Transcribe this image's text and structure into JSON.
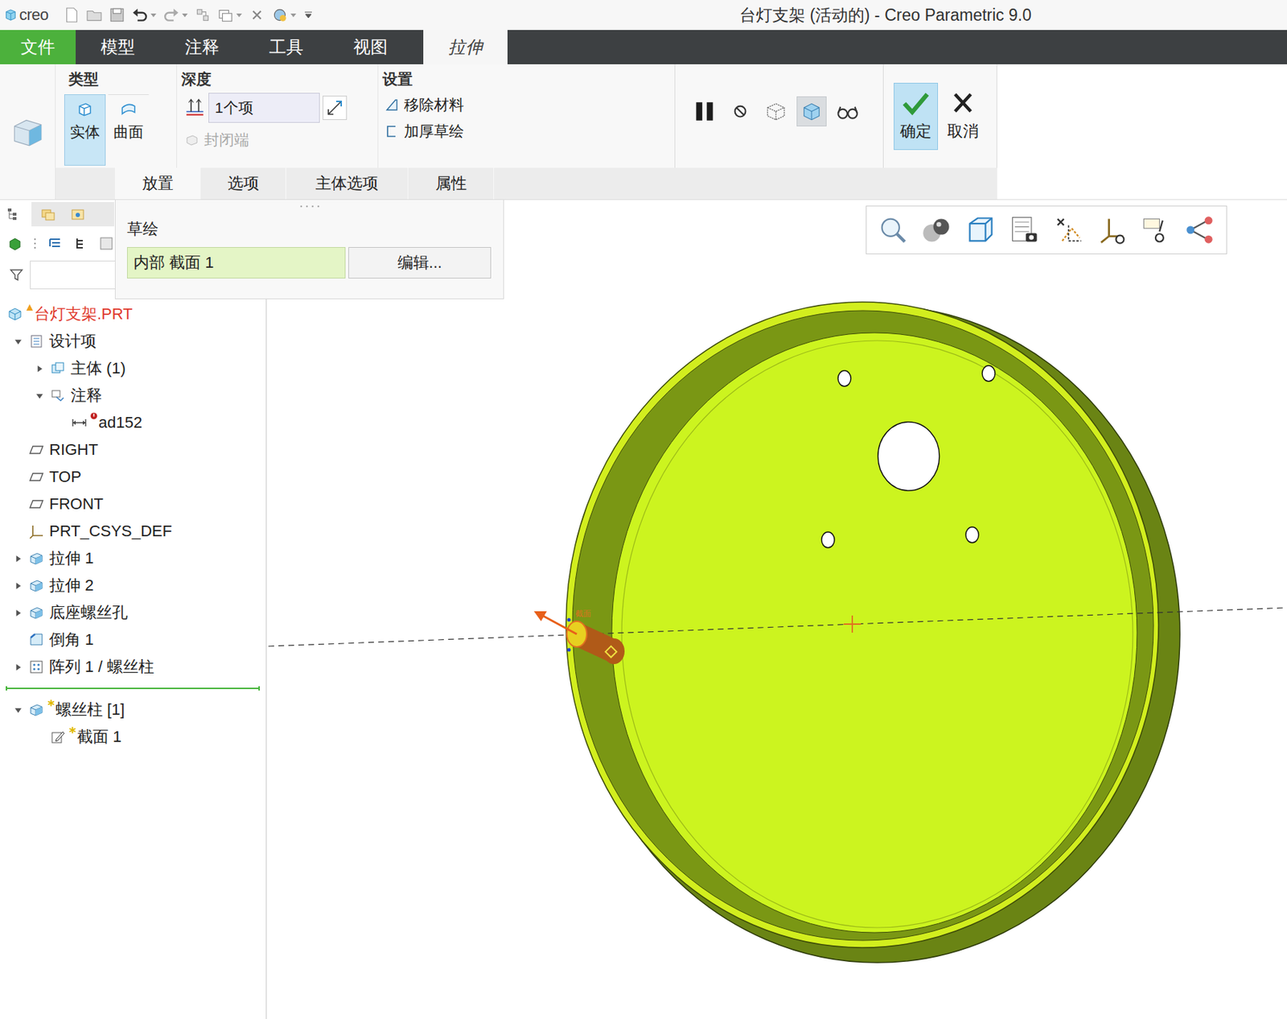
{
  "window": {
    "logo": "creo",
    "title": "台灯支架 (活动的) - Creo Parametric 9.0"
  },
  "menu_tabs": [
    {
      "label": "文件",
      "selected": false,
      "kind": "file"
    },
    {
      "label": "模型",
      "selected": false,
      "kind": "normal"
    },
    {
      "label": "注释",
      "selected": false,
      "kind": "normal"
    },
    {
      "label": "工具",
      "selected": false,
      "kind": "normal"
    },
    {
      "label": "视图",
      "selected": false,
      "kind": "normal"
    },
    {
      "label": "拉伸",
      "selected": true,
      "kind": "context"
    }
  ],
  "ribbon": {
    "type": {
      "title": "类型",
      "options": [
        {
          "label": "实体",
          "selected": true,
          "kind": "solid"
        },
        {
          "label": "曲面",
          "selected": false,
          "kind": "surface"
        }
      ]
    },
    "depth": {
      "title": "深度",
      "value": "1个项",
      "closed_ends": {
        "label": "封闭端",
        "disabled": true
      }
    },
    "settings": {
      "title": "设置",
      "options": [
        {
          "label": "移除材料",
          "kind": "remove",
          "checked": false
        },
        {
          "label": "加厚草绘",
          "kind": "thicken",
          "checked": false
        }
      ]
    },
    "controls": [
      {
        "kind": "pause",
        "selected": false
      },
      {
        "kind": "no-preview",
        "selected": false
      },
      {
        "kind": "geometry-check",
        "selected": false
      },
      {
        "kind": "preview",
        "selected": true
      },
      {
        "kind": "verify",
        "selected": false
      }
    ],
    "ok": {
      "label": "确定",
      "selected": true
    },
    "cancel": {
      "label": "取消"
    }
  },
  "sub_tabs": [
    {
      "label": "放置",
      "selected": true
    },
    {
      "label": "选项",
      "selected": false
    },
    {
      "label": "主体选项",
      "selected": false
    },
    {
      "label": "属性",
      "selected": false
    }
  ],
  "placement_panel": {
    "title": "草绘",
    "sketch": "内部 截面 1",
    "edit_button": "编辑..."
  },
  "filter": {
    "value": ""
  },
  "model_tree": {
    "insert_after": "阵列 1 / 螺丝柱",
    "items": [
      {
        "label": "台灯支架.PRT",
        "kind": "part",
        "depth": 0,
        "expandable": false,
        "expanded": false,
        "warning": true,
        "error": false,
        "new": false
      },
      {
        "label": "设计项",
        "kind": "design-items",
        "depth": 1,
        "expandable": true,
        "expanded": true,
        "warning": false,
        "error": false,
        "new": false
      },
      {
        "label": "主体 (1)",
        "kind": "body",
        "depth": 2,
        "expandable": true,
        "expanded": false,
        "warning": false,
        "error": false,
        "new": false
      },
      {
        "label": "注释",
        "kind": "annotation",
        "depth": 2,
        "expandable": true,
        "expanded": true,
        "warning": false,
        "error": false,
        "new": false
      },
      {
        "label": "ad152",
        "kind": "dimension",
        "depth": 3,
        "expandable": false,
        "expanded": false,
        "warning": false,
        "error": true,
        "new": false
      },
      {
        "label": "RIGHT",
        "kind": "plane",
        "depth": 1,
        "expandable": false,
        "expanded": false,
        "warning": false,
        "error": false,
        "new": false
      },
      {
        "label": "TOP",
        "kind": "plane",
        "depth": 1,
        "expandable": false,
        "expanded": false,
        "warning": false,
        "error": false,
        "new": false
      },
      {
        "label": "FRONT",
        "kind": "plane",
        "depth": 1,
        "expandable": false,
        "expanded": false,
        "warning": false,
        "error": false,
        "new": false
      },
      {
        "label": "PRT_CSYS_DEF",
        "kind": "csys",
        "depth": 1,
        "expandable": false,
        "expanded": false,
        "warning": false,
        "error": false,
        "new": false
      },
      {
        "label": "拉伸 1",
        "kind": "extrude",
        "depth": 1,
        "expandable": true,
        "expanded": false,
        "warning": false,
        "error": false,
        "new": false
      },
      {
        "label": "拉伸 2",
        "kind": "extrude",
        "depth": 1,
        "expandable": true,
        "expanded": false,
        "warning": false,
        "error": false,
        "new": false
      },
      {
        "label": "底座螺丝孔",
        "kind": "extrude",
        "depth": 1,
        "expandable": true,
        "expanded": false,
        "warning": false,
        "error": false,
        "new": false
      },
      {
        "label": "倒角 1",
        "kind": "chamfer",
        "depth": 1,
        "expandable": false,
        "expanded": false,
        "warning": false,
        "error": false,
        "new": false
      },
      {
        "label": "阵列 1 / 螺丝柱",
        "kind": "pattern",
        "depth": 1,
        "expandable": true,
        "expanded": false,
        "warning": false,
        "error": false,
        "new": false
      },
      {
        "label": "螺丝柱 [1]",
        "kind": "extrude",
        "depth": 1,
        "expandable": true,
        "expanded": true,
        "warning": false,
        "error": false,
        "new": true
      },
      {
        "label": "截面 1",
        "kind": "sketch",
        "depth": 2,
        "expandable": false,
        "expanded": false,
        "warning": false,
        "error": false,
        "new": true
      }
    ]
  },
  "viewport": {
    "sketch_label": "截面"
  }
}
